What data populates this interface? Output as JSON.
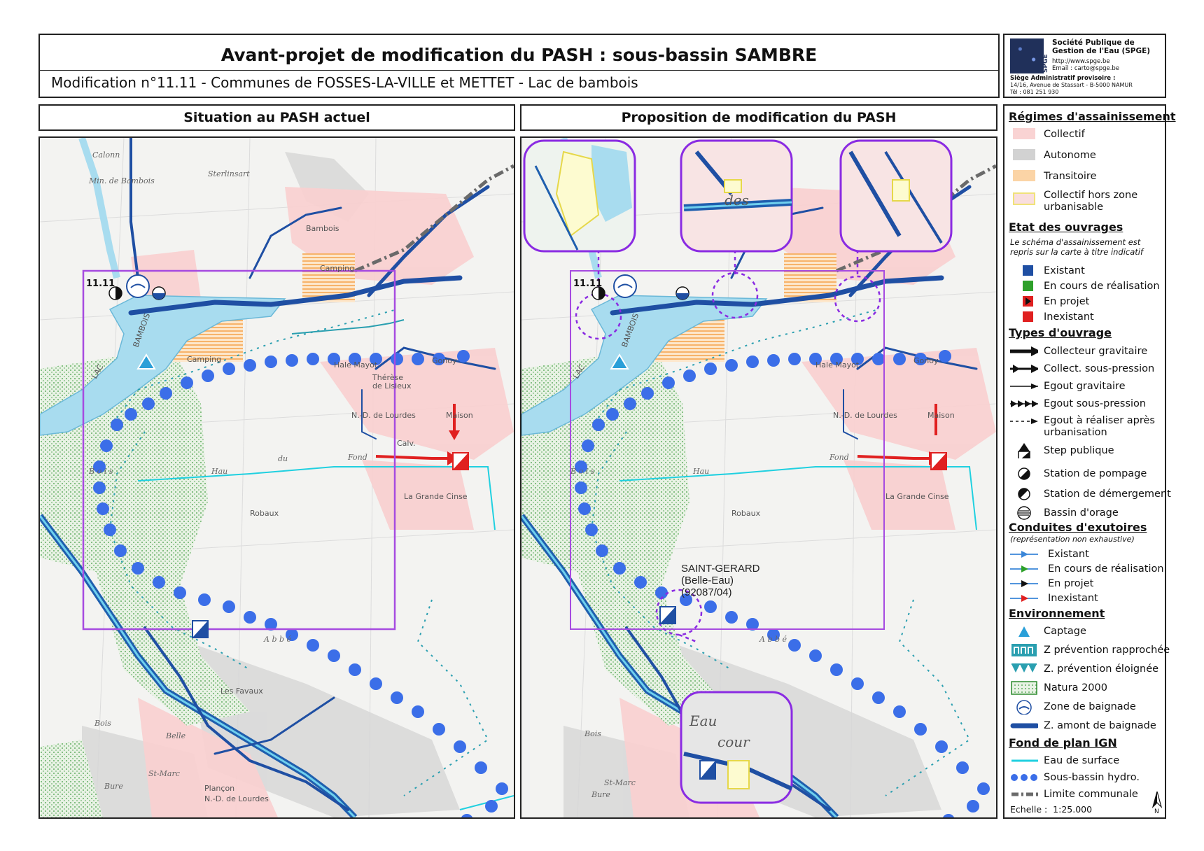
{
  "header": {
    "title": "Avant-projet de modification du PASH : sous-bassin SAMBRE",
    "subtitle": "Modification n°11.11 - Communes de FOSSES-LA-VILLE et METTET -  Lac de bambois"
  },
  "logo": {
    "vertical_text": "SPGE",
    "org_name": "Société Publique de Gestion de l'Eau (SPGE)",
    "web": "http://www.spge.be",
    "email": "Email : carto@spge.be",
    "address_title": "Siège Administratif provisoire :",
    "address": "14/16, Avenue de Stassart - B-5000 NAMUR",
    "phone": "Tél : 081 251 930"
  },
  "panels": {
    "left_title": "Situation au PASH actuel",
    "right_title": "Proposition de modification du PASH"
  },
  "map_labels": {
    "zone_id": "11.11",
    "lake": "LAC",
    "lake2": "BAMBOIS",
    "bambois": "Bambois",
    "camping": "Camping",
    "camping2": "Camping",
    "gonoy": "Gonoy",
    "hale_mayot": "Hale Mayot",
    "therese": "Thérèse",
    "lisieux": "de Lisieux",
    "nd_lourdes": "N.-D. de Lourdes",
    "maison": "Maison",
    "calv": "Calv.",
    "grande_cinse": "La Grande Cinse",
    "robaux": "Robaux",
    "les_favaux": "Les Favaux",
    "bois_de_belle": "Bois",
    "belle": "Belle",
    "st_marc": "St-Marc",
    "bure": "Bure",
    "plancon": "Plançon",
    "nd_lourdes2": "N.-D. de Lourdes",
    "hau": "Hau",
    "fond": "Fond",
    "du": "du",
    "abbe": "A b b é",
    "bois_big": "B o i s",
    "sterlinsart": "Sterlinsart",
    "calonn": "Calonn",
    "moulin": "Min. de Bambois",
    "eau": "Eau",
    "cour": "cour",
    "des": "des",
    "saint_gerard_1": "SAINT-GERARD",
    "saint_gerard_2": "(Belle-Eau)",
    "saint_gerard_3": "(92087/04)"
  },
  "legend": {
    "regimes_title": "Régimes d'assainissement",
    "regimes": [
      {
        "label": "Collectif",
        "color": "#f9d3d3"
      },
      {
        "label": "Autonome",
        "color": "#d2d2d2"
      },
      {
        "label": "Transitoire",
        "color": "#fbd4a6"
      },
      {
        "label": "Collectif hors zone urbanisable",
        "color": "#f9dede"
      }
    ],
    "etat_title": "Etat des ouvrages",
    "etat_note": "Le schéma d'assainissement est repris sur la carte à titre indicatif",
    "etat": [
      {
        "label": "Existant",
        "color": "#1f4fa3"
      },
      {
        "label": "En cours de réalisation",
        "color": "#2ea02a"
      },
      {
        "label": "En projet",
        "color": "#e02020"
      },
      {
        "label": "Inexistant",
        "color": "#e02020"
      }
    ],
    "types_title": "Types d'ouvrage",
    "types": [
      {
        "label": "Collecteur gravitaire"
      },
      {
        "label": "Collect. sous-pression"
      },
      {
        "label": "Egout gravitaire"
      },
      {
        "label": "Egout sous-pression"
      },
      {
        "label": "Egout à réaliser après urbanisation"
      },
      {
        "label": "Step publique"
      },
      {
        "label": "Station de pompage"
      },
      {
        "label": "Station de démergement"
      },
      {
        "label": "Bassin d'orage"
      }
    ],
    "exutoires_title": "Conduites d'exutoires",
    "exutoires_note": "(représentation non exhaustive)",
    "exutoires": [
      {
        "label": "Existant",
        "color": "#3a86d8"
      },
      {
        "label": "En cours de réalisation",
        "color": "#2ea02a"
      },
      {
        "label": "En projet",
        "color": "#111111"
      },
      {
        "label": "Inexistant",
        "color": "#e02020"
      }
    ],
    "env_title": "Environnement",
    "env": [
      {
        "label": "Captage"
      },
      {
        "label": "Z prévention rapprochée"
      },
      {
        "label": "Z. prévention éloignée"
      },
      {
        "label": "Natura 2000"
      },
      {
        "label": "Zone de baignade"
      },
      {
        "label": "Z. amont de baignade"
      }
    ],
    "ign_title": "Fond de plan IGN",
    "ign": [
      {
        "label": "Eau de surface"
      },
      {
        "label": "Sous-bassin hydro."
      },
      {
        "label": "Limite communale"
      }
    ],
    "scale_label": "Echelle :",
    "scale_value": "1:25.000",
    "north": "N"
  }
}
